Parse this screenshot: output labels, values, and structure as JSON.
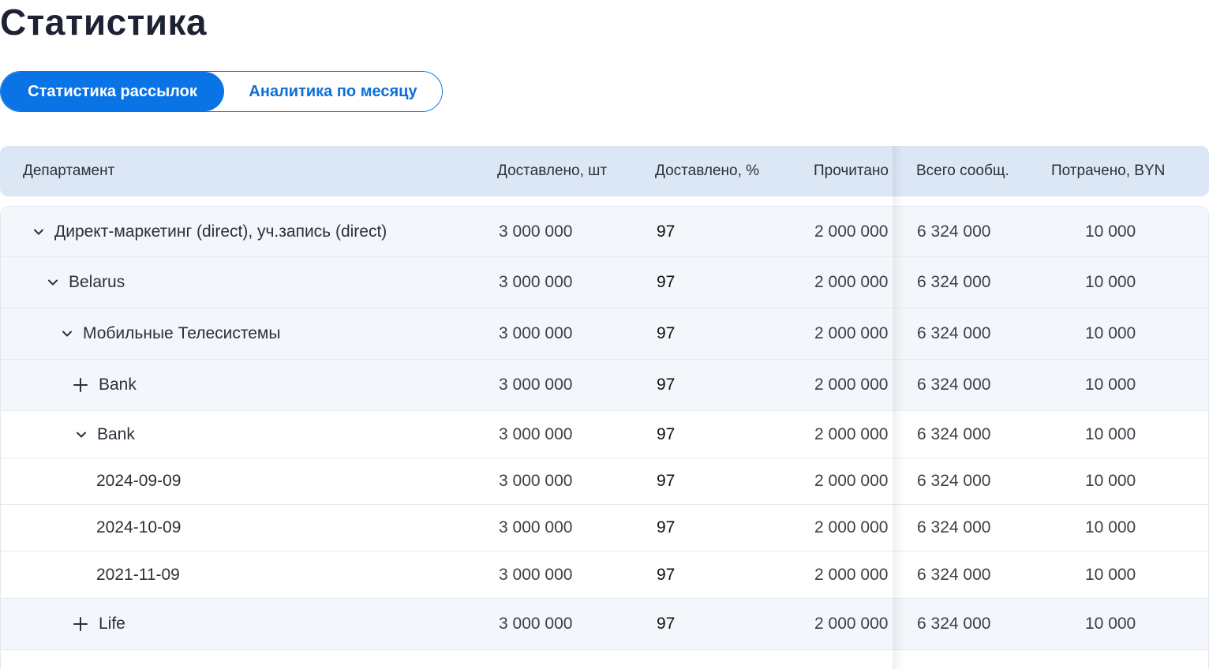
{
  "page": {
    "title": "Статистика"
  },
  "tabs": [
    {
      "label": "Статистика рассылок",
      "active": true
    },
    {
      "label": "Аналитика по месяцу",
      "active": false
    }
  ],
  "colors": {
    "accent": "#0a73e6",
    "header_bg": "#dce7f6",
    "row_shaded": "#f3f6fa"
  },
  "table": {
    "columns": [
      "Департамент",
      "Доставлено, шт",
      "Доставлено, %",
      "Прочитано",
      "Всего сообщ.",
      "Потрачено, BYN"
    ],
    "rows": [
      {
        "name": "Директ-маркетинг (direct), уч.запись (direct)",
        "toggle": "chevron-down",
        "delivered": "3 000 000",
        "percent": "97",
        "read": "2 000 000",
        "total": "6 324 000",
        "spent": "10 000"
      },
      {
        "name": "Belarus",
        "toggle": "chevron-down",
        "delivered": "3 000 000",
        "percent": "97",
        "read": "2 000 000",
        "total": "6 324 000",
        "spent": "10 000"
      },
      {
        "name": "Мобильные Телесистемы",
        "toggle": "chevron-down",
        "delivered": "3 000 000",
        "percent": "97",
        "read": "2 000 000",
        "total": "6 324 000",
        "spent": "10 000"
      },
      {
        "name": "Bank",
        "toggle": "plus",
        "delivered": "3 000 000",
        "percent": "97",
        "read": "2 000 000",
        "total": "6 324 000",
        "spent": "10 000"
      },
      {
        "name": "Bank",
        "toggle": "chevron-down",
        "delivered": "3 000 000",
        "percent": "97",
        "read": "2 000 000",
        "total": "6 324 000",
        "spent": "10 000"
      },
      {
        "name": "2024-09-09",
        "toggle": "none",
        "delivered": "3 000 000",
        "percent": "97",
        "read": "2 000 000",
        "total": "6 324 000",
        "spent": "10 000"
      },
      {
        "name": "2024-10-09",
        "toggle": "none",
        "delivered": "3 000 000",
        "percent": "97",
        "read": "2 000 000",
        "total": "6 324 000",
        "spent": "10 000"
      },
      {
        "name": "2021-11-09",
        "toggle": "none",
        "delivered": "3 000 000",
        "percent": "97",
        "read": "2 000 000",
        "total": "6 324 000",
        "spent": "10 000"
      },
      {
        "name": "Life",
        "toggle": "plus",
        "delivered": "3 000 000",
        "percent": "97",
        "read": "2 000 000",
        "total": "6 324 000",
        "spent": "10 000"
      }
    ]
  }
}
